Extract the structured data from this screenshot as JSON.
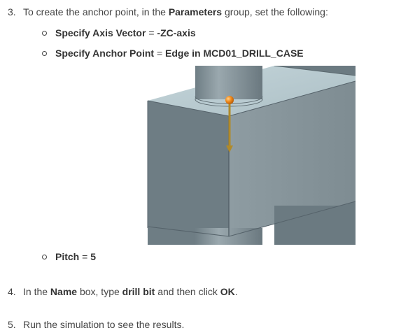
{
  "step3": {
    "num": "3.",
    "text_a": "To create the anchor point, in the ",
    "bold": "Parameters",
    "text_b": " group, set the following:",
    "bullets": [
      {
        "label": "Specify Axis Vector",
        "sep": " = ",
        "value": "-ZC-axis"
      },
      {
        "label": "Specify Anchor Point",
        "sep": " = ",
        "value": "Edge in MCD01_DRILL_CASE"
      },
      {
        "label": "Pitch",
        "sep": " = ",
        "value": "5"
      }
    ]
  },
  "step4": {
    "num": "4.",
    "t1": "In the ",
    "b1": "Name",
    "t2": " box, type ",
    "b2": "drill bit",
    "t3": " and then click ",
    "b3": "OK",
    "t4": "."
  },
  "step5": {
    "num": "5.",
    "text": "Run the simulation to see the results."
  },
  "figure": {
    "colors": {
      "background": "#ffffff",
      "top_face": "#b9cbd1",
      "front_face": "#6b7a81",
      "side_face": "#88969c",
      "cylinder": "#7a8990",
      "anchor_point": "#f08a1c",
      "axis_vector": "#b08a2a"
    }
  }
}
